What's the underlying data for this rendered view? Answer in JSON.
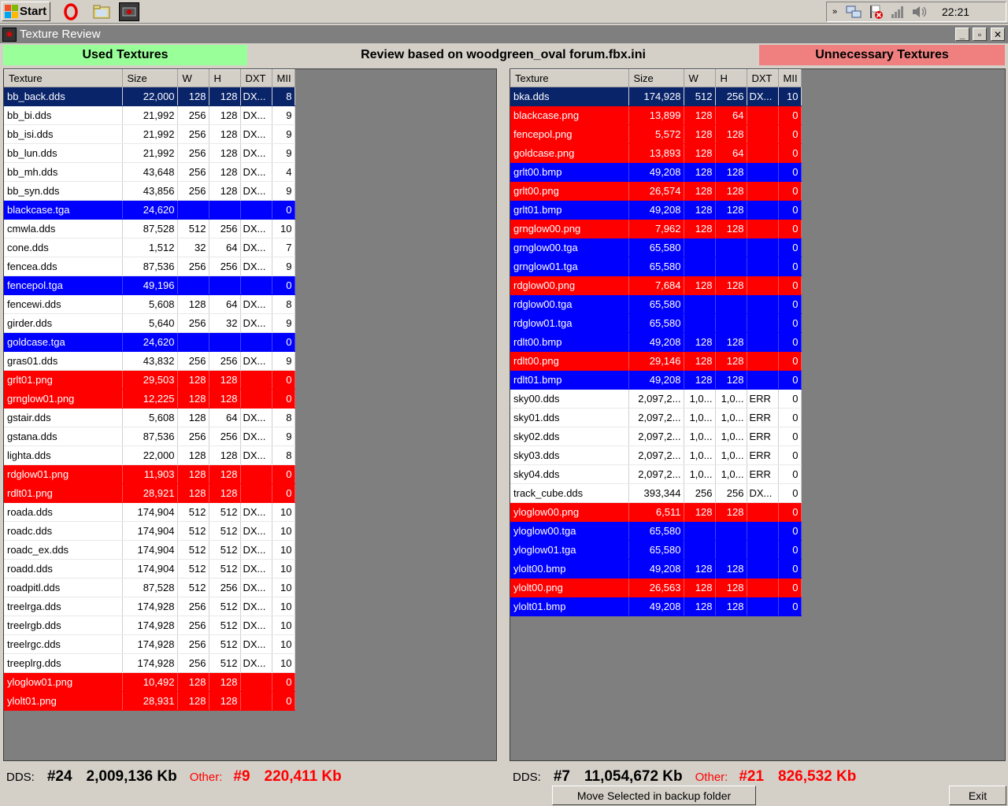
{
  "taskbar": {
    "start_label": "Start",
    "icons": [
      "opera-icon",
      "folder-icon",
      "app-icon"
    ],
    "tray_icons": [
      "chevron-icon",
      "network-icon",
      "flag-error-icon",
      "signal-icon",
      "volume-icon"
    ],
    "clock": "22:21"
  },
  "window": {
    "title": "Texture Review",
    "minimize": "_",
    "maximize": "▫",
    "close": "✕"
  },
  "header": {
    "used_label": "Used Textures",
    "review_label": "Review based on woodgreen_oval forum.fbx.ini",
    "unnecessary_label": "Unnecessary Textures",
    "used_color": "#99ff99",
    "unnecessary_color": "#f08080"
  },
  "columns": [
    "Texture",
    "Size",
    "W",
    "H",
    "DXT",
    "MII"
  ],
  "used_rows": [
    {
      "name": "bb_back.dds",
      "size": "22,000",
      "w": "128",
      "h": "128",
      "dxt": "DX...",
      "mip": "8",
      "style": "navy"
    },
    {
      "name": "bb_bi.dds",
      "size": "21,992",
      "w": "256",
      "h": "128",
      "dxt": "DX...",
      "mip": "9",
      "style": "white"
    },
    {
      "name": "bb_isi.dds",
      "size": "21,992",
      "w": "256",
      "h": "128",
      "dxt": "DX...",
      "mip": "9",
      "style": "white"
    },
    {
      "name": "bb_lun.dds",
      "size": "21,992",
      "w": "256",
      "h": "128",
      "dxt": "DX...",
      "mip": "9",
      "style": "white"
    },
    {
      "name": "bb_mh.dds",
      "size": "43,648",
      "w": "256",
      "h": "128",
      "dxt": "DX...",
      "mip": "4",
      "style": "white"
    },
    {
      "name": "bb_syn.dds",
      "size": "43,856",
      "w": "256",
      "h": "128",
      "dxt": "DX...",
      "mip": "9",
      "style": "white"
    },
    {
      "name": "blackcase.tga",
      "size": "24,620",
      "w": "",
      "h": "",
      "dxt": "",
      "mip": "0",
      "style": "blue"
    },
    {
      "name": "cmwla.dds",
      "size": "87,528",
      "w": "512",
      "h": "256",
      "dxt": "DX...",
      "mip": "10",
      "style": "white"
    },
    {
      "name": "cone.dds",
      "size": "1,512",
      "w": "32",
      "h": "64",
      "dxt": "DX...",
      "mip": "7",
      "style": "white"
    },
    {
      "name": "fencea.dds",
      "size": "87,536",
      "w": "256",
      "h": "256",
      "dxt": "DX...",
      "mip": "9",
      "style": "white"
    },
    {
      "name": "fencepol.tga",
      "size": "49,196",
      "w": "",
      "h": "",
      "dxt": "",
      "mip": "0",
      "style": "blue"
    },
    {
      "name": "fencewi.dds",
      "size": "5,608",
      "w": "128",
      "h": "64",
      "dxt": "DX...",
      "mip": "8",
      "style": "white"
    },
    {
      "name": "girder.dds",
      "size": "5,640",
      "w": "256",
      "h": "32",
      "dxt": "DX...",
      "mip": "9",
      "style": "white"
    },
    {
      "name": "goldcase.tga",
      "size": "24,620",
      "w": "",
      "h": "",
      "dxt": "",
      "mip": "0",
      "style": "blue"
    },
    {
      "name": "gras01.dds",
      "size": "43,832",
      "w": "256",
      "h": "256",
      "dxt": "DX...",
      "mip": "9",
      "style": "white"
    },
    {
      "name": "grlt01.png",
      "size": "29,503",
      "w": "128",
      "h": "128",
      "dxt": "",
      "mip": "0",
      "style": "red"
    },
    {
      "name": "grnglow01.png",
      "size": "12,225",
      "w": "128",
      "h": "128",
      "dxt": "",
      "mip": "0",
      "style": "red"
    },
    {
      "name": "gstair.dds",
      "size": "5,608",
      "w": "128",
      "h": "64",
      "dxt": "DX...",
      "mip": "8",
      "style": "white"
    },
    {
      "name": "gstana.dds",
      "size": "87,536",
      "w": "256",
      "h": "256",
      "dxt": "DX...",
      "mip": "9",
      "style": "white"
    },
    {
      "name": "lighta.dds",
      "size": "22,000",
      "w": "128",
      "h": "128",
      "dxt": "DX...",
      "mip": "8",
      "style": "white"
    },
    {
      "name": "rdglow01.png",
      "size": "11,903",
      "w": "128",
      "h": "128",
      "dxt": "",
      "mip": "0",
      "style": "red"
    },
    {
      "name": "rdlt01.png",
      "size": "28,921",
      "w": "128",
      "h": "128",
      "dxt": "",
      "mip": "0",
      "style": "red"
    },
    {
      "name": "roada.dds",
      "size": "174,904",
      "w": "512",
      "h": "512",
      "dxt": "DX...",
      "mip": "10",
      "style": "white"
    },
    {
      "name": "roadc.dds",
      "size": "174,904",
      "w": "512",
      "h": "512",
      "dxt": "DX...",
      "mip": "10",
      "style": "white"
    },
    {
      "name": "roadc_ex.dds",
      "size": "174,904",
      "w": "512",
      "h": "512",
      "dxt": "DX...",
      "mip": "10",
      "style": "white"
    },
    {
      "name": "roadd.dds",
      "size": "174,904",
      "w": "512",
      "h": "512",
      "dxt": "DX...",
      "mip": "10",
      "style": "white"
    },
    {
      "name": "roadpitl.dds",
      "size": "87,528",
      "w": "512",
      "h": "256",
      "dxt": "DX...",
      "mip": "10",
      "style": "white"
    },
    {
      "name": "treelrga.dds",
      "size": "174,928",
      "w": "256",
      "h": "512",
      "dxt": "DX...",
      "mip": "10",
      "style": "white"
    },
    {
      "name": "treelrgb.dds",
      "size": "174,928",
      "w": "256",
      "h": "512",
      "dxt": "DX...",
      "mip": "10",
      "style": "white"
    },
    {
      "name": "treelrgc.dds",
      "size": "174,928",
      "w": "256",
      "h": "512",
      "dxt": "DX...",
      "mip": "10",
      "style": "white"
    },
    {
      "name": "treeplrg.dds",
      "size": "174,928",
      "w": "256",
      "h": "512",
      "dxt": "DX...",
      "mip": "10",
      "style": "white"
    },
    {
      "name": "yloglow01.png",
      "size": "10,492",
      "w": "128",
      "h": "128",
      "dxt": "",
      "mip": "0",
      "style": "red"
    },
    {
      "name": "ylolt01.png",
      "size": "28,931",
      "w": "128",
      "h": "128",
      "dxt": "",
      "mip": "0",
      "style": "red"
    }
  ],
  "unnecessary_rows": [
    {
      "name": "bka.dds",
      "size": "174,928",
      "w": "512",
      "h": "256",
      "dxt": "DX...",
      "mip": "10",
      "style": "navy"
    },
    {
      "name": "blackcase.png",
      "size": "13,899",
      "w": "128",
      "h": "64",
      "dxt": "",
      "mip": "0",
      "style": "red"
    },
    {
      "name": "fencepol.png",
      "size": "5,572",
      "w": "128",
      "h": "128",
      "dxt": "",
      "mip": "0",
      "style": "red"
    },
    {
      "name": "goldcase.png",
      "size": "13,893",
      "w": "128",
      "h": "64",
      "dxt": "",
      "mip": "0",
      "style": "red"
    },
    {
      "name": "grlt00.bmp",
      "size": "49,208",
      "w": "128",
      "h": "128",
      "dxt": "",
      "mip": "0",
      "style": "blue"
    },
    {
      "name": "grlt00.png",
      "size": "26,574",
      "w": "128",
      "h": "128",
      "dxt": "",
      "mip": "0",
      "style": "red"
    },
    {
      "name": "grlt01.bmp",
      "size": "49,208",
      "w": "128",
      "h": "128",
      "dxt": "",
      "mip": "0",
      "style": "blue"
    },
    {
      "name": "grnglow00.png",
      "size": "7,962",
      "w": "128",
      "h": "128",
      "dxt": "",
      "mip": "0",
      "style": "red"
    },
    {
      "name": "grnglow00.tga",
      "size": "65,580",
      "w": "",
      "h": "",
      "dxt": "",
      "mip": "0",
      "style": "blue"
    },
    {
      "name": "grnglow01.tga",
      "size": "65,580",
      "w": "",
      "h": "",
      "dxt": "",
      "mip": "0",
      "style": "blue"
    },
    {
      "name": "rdglow00.png",
      "size": "7,684",
      "w": "128",
      "h": "128",
      "dxt": "",
      "mip": "0",
      "style": "red"
    },
    {
      "name": "rdglow00.tga",
      "size": "65,580",
      "w": "",
      "h": "",
      "dxt": "",
      "mip": "0",
      "style": "blue"
    },
    {
      "name": "rdglow01.tga",
      "size": "65,580",
      "w": "",
      "h": "",
      "dxt": "",
      "mip": "0",
      "style": "blue"
    },
    {
      "name": "rdlt00.bmp",
      "size": "49,208",
      "w": "128",
      "h": "128",
      "dxt": "",
      "mip": "0",
      "style": "blue"
    },
    {
      "name": "rdlt00.png",
      "size": "29,146",
      "w": "128",
      "h": "128",
      "dxt": "",
      "mip": "0",
      "style": "red"
    },
    {
      "name": "rdlt01.bmp",
      "size": "49,208",
      "w": "128",
      "h": "128",
      "dxt": "",
      "mip": "0",
      "style": "blue"
    },
    {
      "name": "sky00.dds",
      "size": "2,097,2...",
      "w": "1,0...",
      "h": "1,0...",
      "dxt": "ERR",
      "mip": "0",
      "style": "white"
    },
    {
      "name": "sky01.dds",
      "size": "2,097,2...",
      "w": "1,0...",
      "h": "1,0...",
      "dxt": "ERR",
      "mip": "0",
      "style": "white"
    },
    {
      "name": "sky02.dds",
      "size": "2,097,2...",
      "w": "1,0...",
      "h": "1,0...",
      "dxt": "ERR",
      "mip": "0",
      "style": "white"
    },
    {
      "name": "sky03.dds",
      "size": "2,097,2...",
      "w": "1,0...",
      "h": "1,0...",
      "dxt": "ERR",
      "mip": "0",
      "style": "white"
    },
    {
      "name": "sky04.dds",
      "size": "2,097,2...",
      "w": "1,0...",
      "h": "1,0...",
      "dxt": "ERR",
      "mip": "0",
      "style": "white"
    },
    {
      "name": "track_cube.dds",
      "size": "393,344",
      "w": "256",
      "h": "256",
      "dxt": "DX...",
      "mip": "0",
      "style": "white"
    },
    {
      "name": "yloglow00.png",
      "size": "6,511",
      "w": "128",
      "h": "128",
      "dxt": "",
      "mip": "0",
      "style": "red"
    },
    {
      "name": "yloglow00.tga",
      "size": "65,580",
      "w": "",
      "h": "",
      "dxt": "",
      "mip": "0",
      "style": "blue"
    },
    {
      "name": "yloglow01.tga",
      "size": "65,580",
      "w": "",
      "h": "",
      "dxt": "",
      "mip": "0",
      "style": "blue"
    },
    {
      "name": "ylolt00.bmp",
      "size": "49,208",
      "w": "128",
      "h": "128",
      "dxt": "",
      "mip": "0",
      "style": "blue"
    },
    {
      "name": "ylolt00.png",
      "size": "26,563",
      "w": "128",
      "h": "128",
      "dxt": "",
      "mip": "0",
      "style": "red"
    },
    {
      "name": "ylolt01.bmp",
      "size": "49,208",
      "w": "128",
      "h": "128",
      "dxt": "",
      "mip": "0",
      "style": "blue"
    }
  ],
  "left_summary": {
    "dds_label": "DDS:",
    "dds_count": "#24",
    "dds_kb": "2,009,136 Kb",
    "other_label": "Other:",
    "other_count": "#9",
    "other_kb": "220,411 Kb"
  },
  "right_summary": {
    "dds_label": "DDS:",
    "dds_count": "#7",
    "dds_kb": "11,054,672 Kb",
    "other_label": "Other:",
    "other_count": "#21",
    "other_kb": "826,532 Kb"
  },
  "buttons": {
    "move": "Move Selected in backup folder",
    "exit": "Exit"
  },
  "colors": {
    "row_blue": "#0000ff",
    "row_red": "#ff0000",
    "row_selected": "#0a246a",
    "other_text": "#ff0000"
  }
}
